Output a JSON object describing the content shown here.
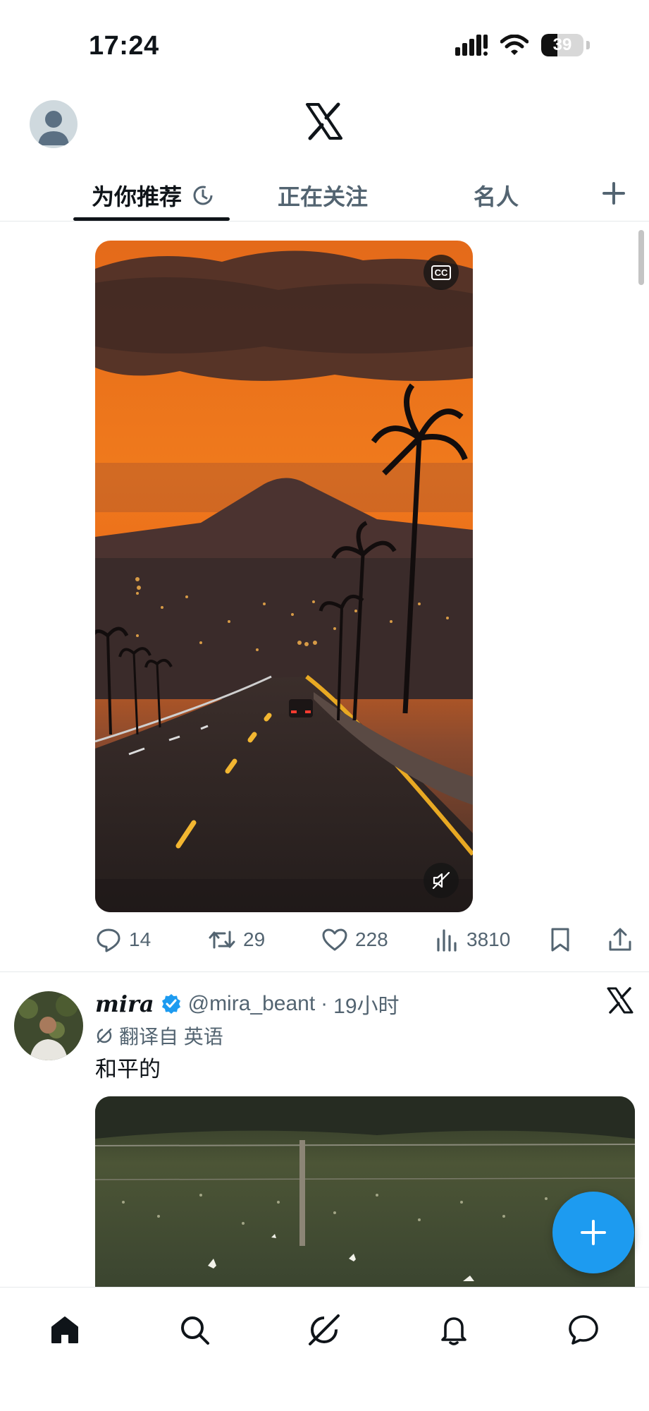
{
  "status_bar": {
    "time": "17:24",
    "battery": "39",
    "battery_level": 0.39
  },
  "tabs": [
    {
      "label": "为你推荐",
      "active": true
    },
    {
      "label": "正在关注",
      "active": false
    },
    {
      "label": "名人",
      "active": false
    }
  ],
  "tweet1": {
    "actions": {
      "replies": "14",
      "retweets": "29",
      "likes": "228",
      "views": "3810"
    },
    "media_badges": {
      "captions": "CC"
    }
  },
  "tweet2": {
    "name": "mira",
    "handle": "@mira_beant",
    "separator": "·",
    "time": "19小时",
    "translated_note": "翻译自 英语",
    "text": "和平的"
  },
  "icons": {
    "reply": "reply-icon",
    "retweet": "retweet-icon",
    "like": "heart-icon",
    "views": "views-icon",
    "bookmark": "bookmark-icon",
    "share": "share-icon",
    "home": "home-icon",
    "search": "search-icon",
    "grok": "grok-icon",
    "notifications": "bell-icon",
    "messages": "chat-icon"
  },
  "colors": {
    "accent": "#1d9bf0",
    "text": "#0f1419",
    "muted": "#536471"
  }
}
